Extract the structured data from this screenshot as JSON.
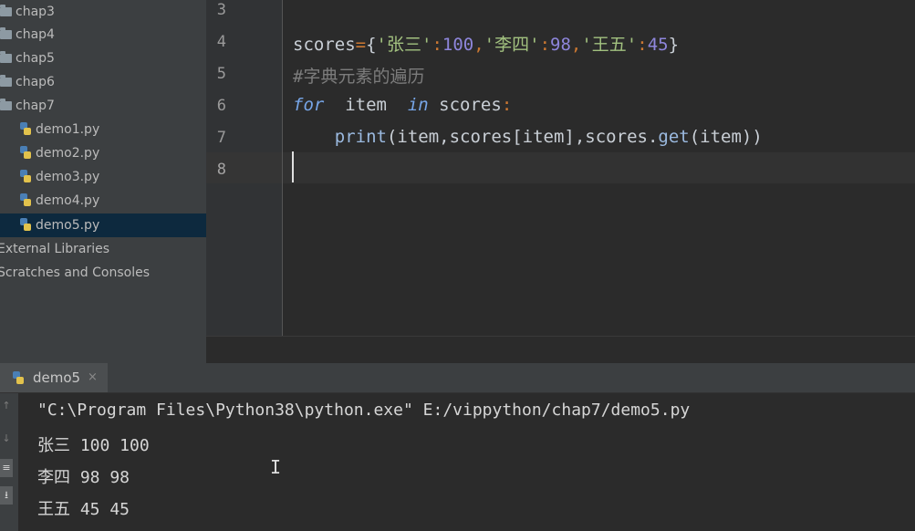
{
  "project_tree": {
    "folders": [
      "chap3",
      "chap4",
      "chap5",
      "chap6",
      "chap7"
    ],
    "files": [
      "demo1.py",
      "demo2.py",
      "demo3.py",
      "demo4.py",
      "demo5.py"
    ],
    "selected_file": "demo5.py",
    "external_libraries": "External Libraries",
    "scratches": "Scratches and Consoles"
  },
  "editor": {
    "line_numbers": [
      "3",
      "4",
      "5",
      "6",
      "7",
      "8"
    ],
    "line4": {
      "var": "scores",
      "eq": "=",
      "open": "{",
      "s1": "'张三'",
      "c1": ":",
      "n1": "100",
      "sep1": ",",
      "s2": "'李四'",
      "c2": ":",
      "n2": "98",
      "sep2": ",",
      "s3": "'王五'",
      "c3": ":",
      "n3": "45",
      "close": "}"
    },
    "line5": "#字典元素的遍历",
    "line6": {
      "for": "for",
      "item": "  item  ",
      "in": "in",
      "rest": " scores",
      "colon": ":"
    },
    "line7": {
      "indent": "    ",
      "print": "print",
      "args1": "(item,scores[item],scores.",
      "get": "get",
      "args2": "(item))"
    }
  },
  "run_panel": {
    "tab_label": "demo5",
    "close_symbol": "×",
    "output": [
      "\"C:\\Program Files\\Python38\\python.exe\" E:/vippython/chap7/demo5.py",
      "张三 100 100",
      "李四 98 98",
      "王五 45 45"
    ],
    "toolbar_icons": [
      "up-arrow-icon",
      "down-arrow-icon",
      "soft-wrap-icon",
      "scroll-to-end-icon"
    ]
  },
  "colors": {
    "keyword": "#77a6e8",
    "string": "#a2c17f",
    "number": "#8e86dc",
    "comment": "#7c7c7c",
    "selection": "#0d293e"
  }
}
